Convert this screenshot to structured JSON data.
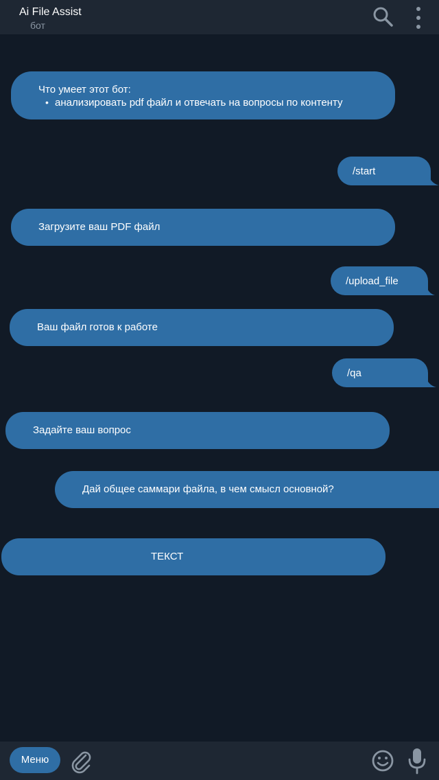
{
  "header": {
    "title": "Ai File Assist",
    "subtitle": "бот",
    "search_icon": "search-icon",
    "more_icon": "more-vertical-icon"
  },
  "messages": [
    {
      "side": "incoming",
      "title": "Что умеет этот бот:",
      "bullet": "•",
      "item": "анализировать pdf файл и отвечать на вопросы по контенту"
    },
    {
      "side": "outgoing",
      "text": "/start"
    },
    {
      "side": "incoming",
      "text": "Загрузите ваш PDF файл"
    },
    {
      "side": "outgoing",
      "text": "/upload_file"
    },
    {
      "side": "incoming",
      "text": "Ваш файл готов к работе"
    },
    {
      "side": "outgoing",
      "text": "/qa"
    },
    {
      "side": "incoming",
      "text": "Задайте ваш вопрос"
    },
    {
      "side": "outgoing",
      "text": "Дай общее саммари файла, в чем смысл основной?"
    },
    {
      "side": "incoming",
      "text": "ТЕКСТ"
    }
  ],
  "input_bar": {
    "menu_label": "Меню",
    "attach_icon": "paperclip-icon",
    "emoji_icon": "emoji-icon",
    "mic_icon": "microphone-icon"
  },
  "colors": {
    "background": "#111a26",
    "bars": "#1e2733",
    "bubble": "#2f6ea5",
    "icon": "#8a96a3"
  }
}
